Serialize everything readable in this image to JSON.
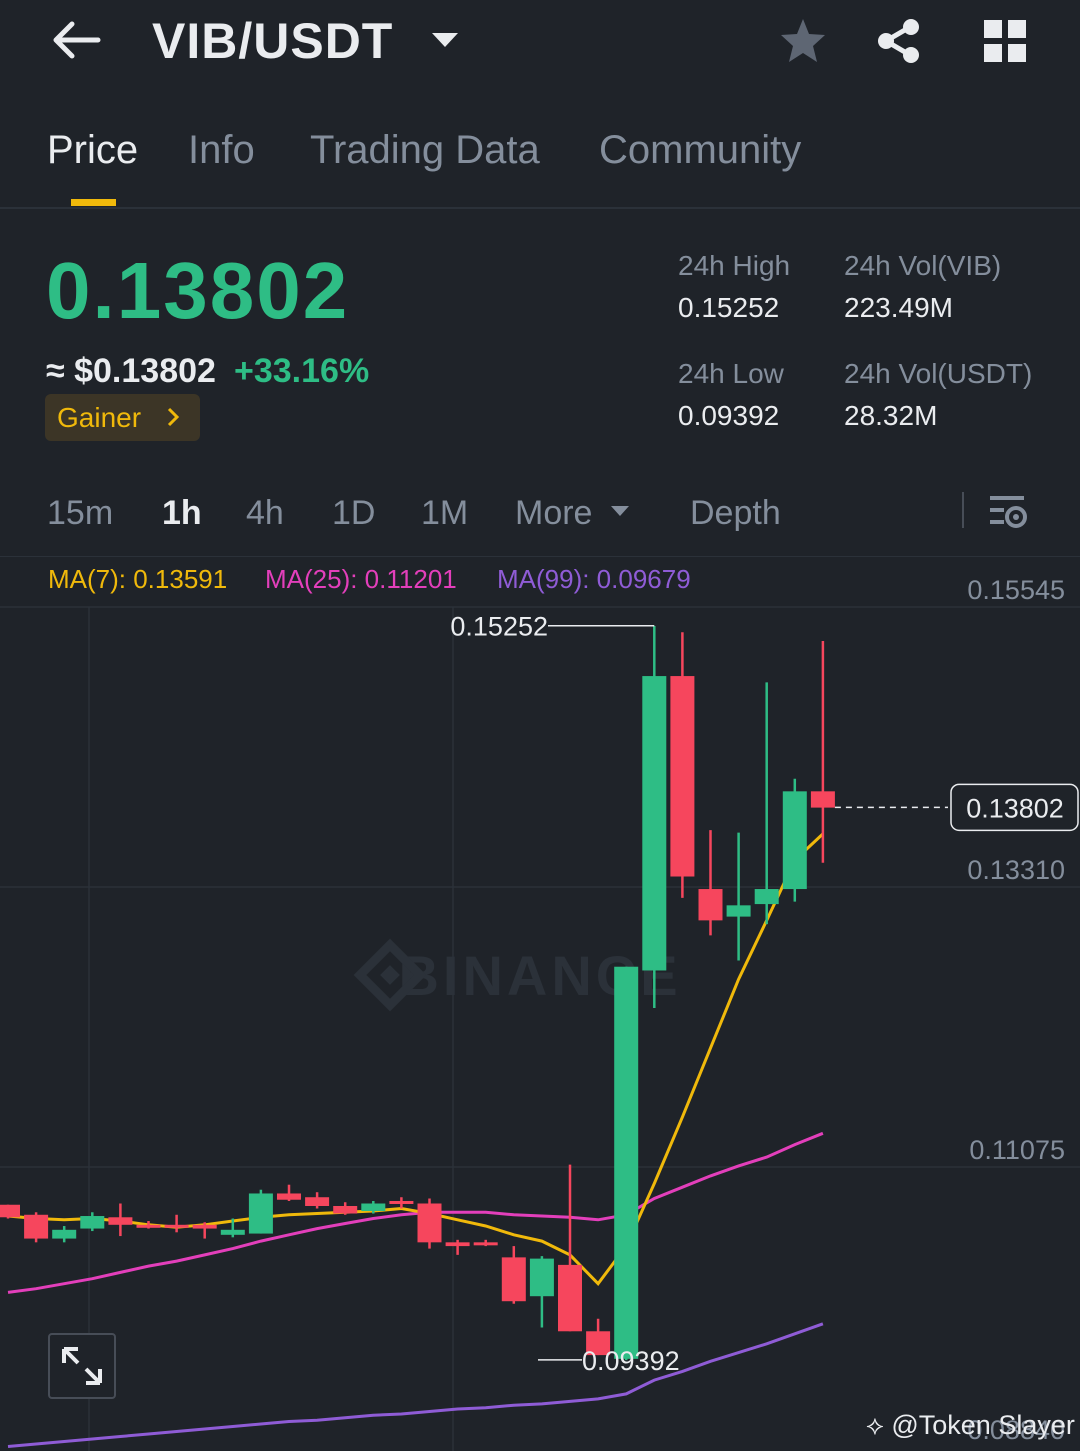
{
  "header": {
    "pair": "VIB/USDT",
    "icons": {
      "back": "back-arrow-icon",
      "dropdown": "caret-down-icon",
      "favorite": "star-icon",
      "share": "share-icon",
      "more": "grid-icon"
    }
  },
  "tabs": [
    {
      "label": "Price",
      "active": true
    },
    {
      "label": "Info",
      "active": false
    },
    {
      "label": "Trading Data",
      "active": false
    },
    {
      "label": "Community",
      "active": false
    }
  ],
  "ticker": {
    "last_price": "0.13802",
    "usd_price": "≈ $0.13802",
    "change": "+33.16%",
    "badge": "Gainer",
    "stats": {
      "high_label": "24h High",
      "high_value": "0.15252",
      "low_label": "24h Low",
      "low_value": "0.09392",
      "vol_base_label": "24h Vol(VIB)",
      "vol_base_value": "223.49M",
      "vol_quote_label": "24h Vol(USDT)",
      "vol_quote_value": "28.32M"
    }
  },
  "intervals": [
    {
      "label": "15m",
      "active": false
    },
    {
      "label": "1h",
      "active": true
    },
    {
      "label": "4h",
      "active": false
    },
    {
      "label": "1D",
      "active": false
    },
    {
      "label": "1M",
      "active": false
    },
    {
      "label": "More",
      "active": false
    },
    {
      "label": "Depth",
      "active": false
    }
  ],
  "ma_legend": {
    "ma7": "MA(7): 0.13591",
    "ma25": "MA(25): 0.11201",
    "ma99": "MA(99): 0.09679"
  },
  "watermark": "BINANCE",
  "credit": "@Token Slayer",
  "colors": {
    "background": "#1f2329",
    "up": "#2ebd85",
    "down": "#f6465d",
    "accent": "#f0b90b",
    "ma7": "#f0b90b",
    "ma25": "#e33fbb",
    "ma99": "#8f5cd6"
  },
  "chart_data": {
    "type": "candlestick",
    "interval": "1h",
    "y_axis_labels": [
      "0.15545",
      "0.13310",
      "0.11075",
      "0.08840"
    ],
    "ylim": [
      0.0855,
      0.1575
    ],
    "last_price_label": "0.13802",
    "high_marker": "0.15252",
    "low_marker": "0.09392",
    "candles": [
      {
        "o": 0.1063,
        "h": 0.1063,
        "l": 0.1052,
        "c": 0.1053
      },
      {
        "o": 0.1055,
        "h": 0.1057,
        "l": 0.1033,
        "c": 0.1036
      },
      {
        "o": 0.1036,
        "h": 0.1046,
        "l": 0.1033,
        "c": 0.1043
      },
      {
        "o": 0.1044,
        "h": 0.1057,
        "l": 0.1042,
        "c": 0.1054
      },
      {
        "o": 0.1053,
        "h": 0.1064,
        "l": 0.1038,
        "c": 0.1047
      },
      {
        "o": 0.1047,
        "h": 0.105,
        "l": 0.1044,
        "c": 0.1046
      },
      {
        "o": 0.1047,
        "h": 0.1055,
        "l": 0.1041,
        "c": 0.1046
      },
      {
        "o": 0.1047,
        "h": 0.1049,
        "l": 0.1036,
        "c": 0.1044
      },
      {
        "o": 0.1039,
        "h": 0.1052,
        "l": 0.1037,
        "c": 0.1043
      },
      {
        "o": 0.104,
        "h": 0.1075,
        "l": 0.104,
        "c": 0.1072
      },
      {
        "o": 0.1072,
        "h": 0.1079,
        "l": 0.1066,
        "c": 0.1067
      },
      {
        "o": 0.1069,
        "h": 0.1073,
        "l": 0.106,
        "c": 0.1062
      },
      {
        "o": 0.1062,
        "h": 0.1065,
        "l": 0.1055,
        "c": 0.1056
      },
      {
        "o": 0.1058,
        "h": 0.1066,
        "l": 0.1056,
        "c": 0.1064
      },
      {
        "o": 0.1066,
        "h": 0.1069,
        "l": 0.106,
        "c": 0.1064
      },
      {
        "o": 0.1064,
        "h": 0.1068,
        "l": 0.1028,
        "c": 0.1033
      },
      {
        "o": 0.1033,
        "h": 0.1035,
        "l": 0.1023,
        "c": 0.103
      },
      {
        "o": 0.1033,
        "h": 0.1035,
        "l": 0.103,
        "c": 0.1032
      },
      {
        "o": 0.1021,
        "h": 0.103,
        "l": 0.0984,
        "c": 0.0986
      },
      {
        "o": 0.099,
        "h": 0.1022,
        "l": 0.0965,
        "c": 0.102
      },
      {
        "o": 0.1015,
        "h": 0.1095,
        "l": 0.0962,
        "c": 0.0962
      },
      {
        "o": 0.0962,
        "h": 0.0972,
        "l": 0.0943,
        "c": 0.0943
      },
      {
        "o": 0.094,
        "h": 0.1253,
        "l": 0.0939,
        "c": 0.1253
      },
      {
        "o": 0.125,
        "h": 0.1525,
        "l": 0.122,
        "c": 0.1485
      },
      {
        "o": 0.1485,
        "h": 0.152,
        "l": 0.1308,
        "c": 0.1325
      },
      {
        "o": 0.1315,
        "h": 0.1362,
        "l": 0.1278,
        "c": 0.129
      },
      {
        "o": 0.1293,
        "h": 0.136,
        "l": 0.1258,
        "c": 0.1302
      },
      {
        "o": 0.1303,
        "h": 0.148,
        "l": 0.1287,
        "c": 0.1315
      },
      {
        "o": 0.1315,
        "h": 0.1403,
        "l": 0.1305,
        "c": 0.1393
      },
      {
        "o": 0.1393,
        "h": 0.1513,
        "l": 0.1336,
        "c": 0.138
      }
    ],
    "ma7": [
      0.1054,
      0.1052,
      0.1051,
      0.1052,
      0.105,
      0.1047,
      0.1045,
      0.1047,
      0.105,
      0.1053,
      0.1055,
      0.1056,
      0.1057,
      0.1058,
      0.106,
      0.1056,
      0.1051,
      0.1046,
      0.1039,
      0.1034,
      0.1023,
      0.1,
      0.103,
      0.108,
      0.1133,
      0.1188,
      0.1243,
      0.129,
      0.1338,
      0.1359
    ],
    "ma25": [
      0.0993,
      0.0996,
      0.1,
      0.1004,
      0.1009,
      0.1014,
      0.1018,
      0.1023,
      0.1028,
      0.1034,
      0.1039,
      0.1044,
      0.1048,
      0.1052,
      0.1055,
      0.1057,
      0.1057,
      0.1057,
      0.1055,
      0.1054,
      0.1053,
      0.1051,
      0.1055,
      0.1068,
      0.1077,
      0.1086,
      0.1094,
      0.1101,
      0.1111,
      0.112
    ],
    "ma99": [
      0.087,
      0.0872,
      0.0874,
      0.0876,
      0.0878,
      0.088,
      0.0882,
      0.0884,
      0.0886,
      0.0888,
      0.089,
      0.0891,
      0.0893,
      0.0895,
      0.0896,
      0.0898,
      0.09,
      0.0901,
      0.0903,
      0.0904,
      0.0906,
      0.0908,
      0.0912,
      0.0923,
      0.093,
      0.0938,
      0.0945,
      0.0952,
      0.096,
      0.0968
    ]
  }
}
